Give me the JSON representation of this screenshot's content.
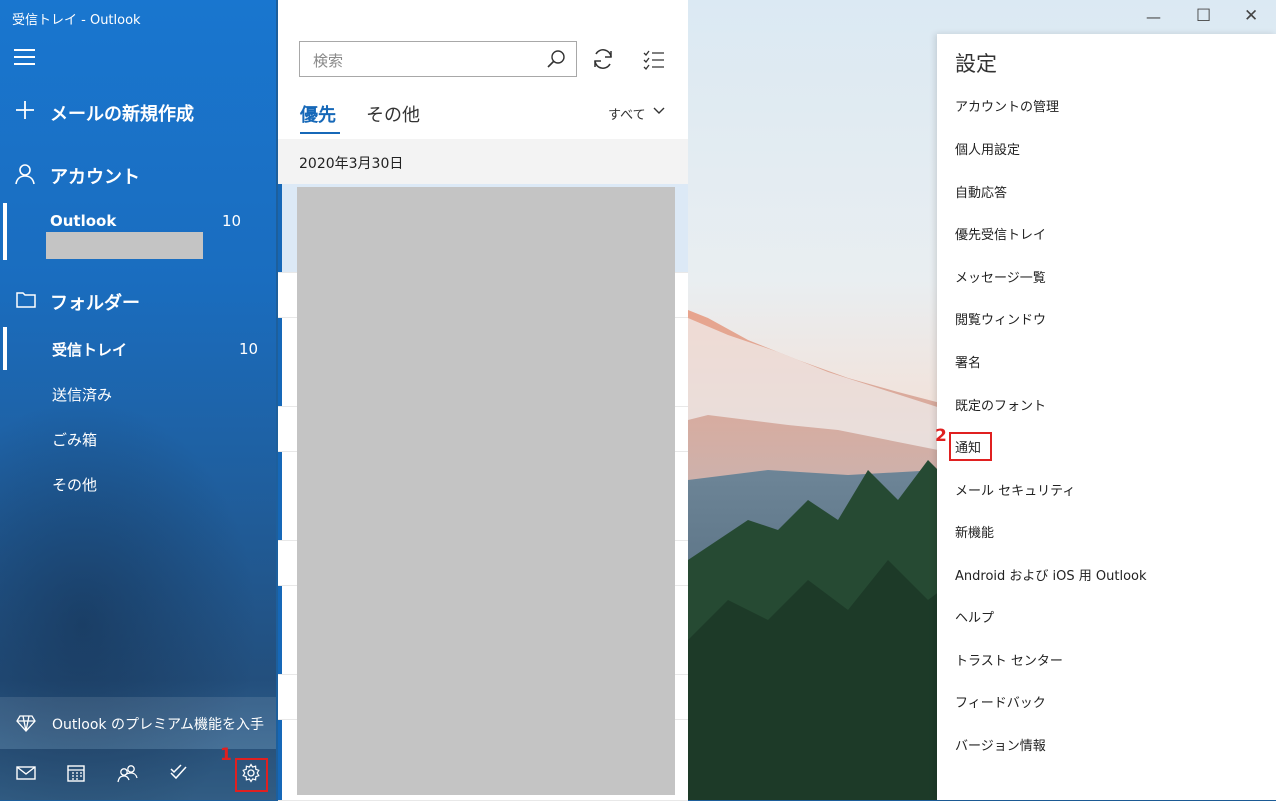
{
  "window": {
    "title": "受信トレイ - Outlook"
  },
  "nav": {
    "new_mail": "メールの新規作成",
    "accounts_header": "アカウント",
    "account": {
      "name": "Outlook",
      "count": "10"
    },
    "folders_header": "フォルダー",
    "folders": [
      {
        "label": "受信トレイ",
        "count": "10"
      },
      {
        "label": "送信済み"
      },
      {
        "label": "ごみ箱"
      },
      {
        "label": "その他"
      }
    ],
    "premium": "Outlook のプレミアム機能を入手",
    "bottom_icons": [
      "mail-icon",
      "calendar-icon",
      "people-icon",
      "todo-icon",
      "gear-icon"
    ]
  },
  "list": {
    "search_placeholder": "検索",
    "tabs": [
      "優先",
      "その他"
    ],
    "filter": "すべて",
    "date_header": "2020年3月30日"
  },
  "settings": {
    "title": "設定",
    "items": [
      "アカウントの管理",
      "個人用設定",
      "自動応答",
      "優先受信トレイ",
      "メッセージ一覧",
      "閲覧ウィンドウ",
      "署名",
      "既定のフォント",
      "通知",
      "メール セキュリティ",
      "新機能",
      "Android および iOS 用 Outlook",
      "ヘルプ",
      "トラスト センター",
      "フィードバック",
      "バージョン情報"
    ]
  },
  "annotations": {
    "step1": "1",
    "step2": "2"
  },
  "colors": {
    "accent": "#1668b8",
    "annotation": "#e02020"
  }
}
